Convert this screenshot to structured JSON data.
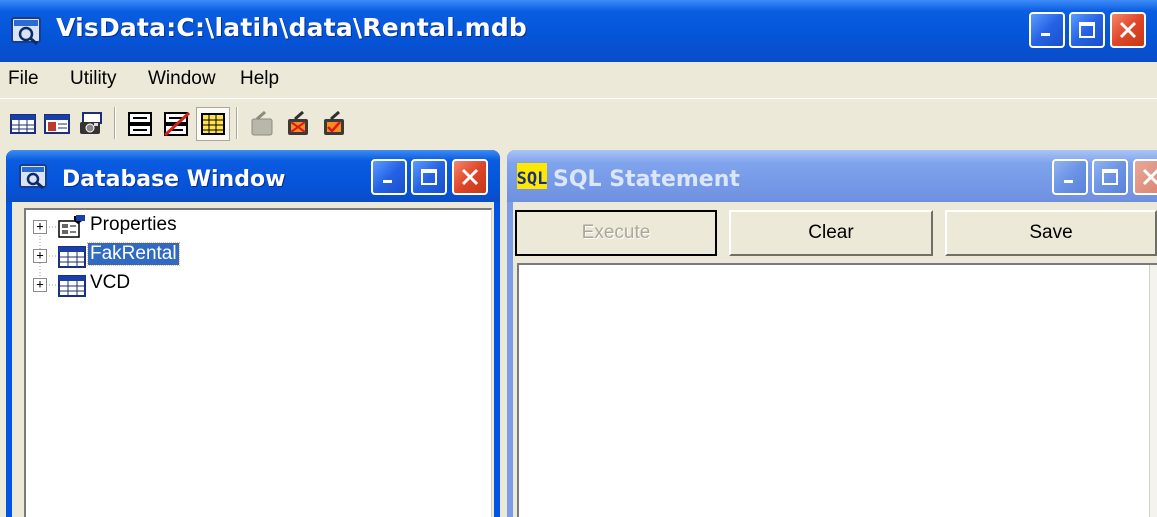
{
  "main_window": {
    "title": "VisData:C:\\latih\\data\\Rental.mdb"
  },
  "menu": {
    "items": [
      {
        "label": "File"
      },
      {
        "label": "Utility"
      },
      {
        "label": "Window"
      },
      {
        "label": "Help"
      }
    ]
  },
  "toolbar": {
    "buttons": [
      {
        "icon": "table-type-icon"
      },
      {
        "icon": "dynaset-type-icon"
      },
      {
        "icon": "snapshot-type-icon"
      },
      {
        "icon": "use-data-control-icon"
      },
      {
        "icon": "no-data-control-icon"
      },
      {
        "icon": "use-dbgrid-icon"
      },
      {
        "icon": "begin-transaction-icon"
      },
      {
        "icon": "rollback-icon"
      },
      {
        "icon": "commit-icon"
      }
    ]
  },
  "database_window": {
    "title": "Database Window",
    "tree": [
      {
        "label": "Properties",
        "icon": "properties-icon",
        "expander": "+"
      },
      {
        "label": "FakRental",
        "icon": "table-icon",
        "expander": "+",
        "selected": true
      },
      {
        "label": "VCD",
        "icon": "table-icon",
        "expander": "+"
      }
    ]
  },
  "sql_window": {
    "title": "SQL Statement",
    "execute_label": "Execute",
    "clear_label": "Clear",
    "save_label": "Save",
    "query_text": ""
  },
  "colors": {
    "titlebar_active": "#0454d8",
    "titlebar_inactive": "#7598e7",
    "face": "#ece9d8",
    "selection": "#316ac5",
    "close_red": "#e0462a"
  }
}
